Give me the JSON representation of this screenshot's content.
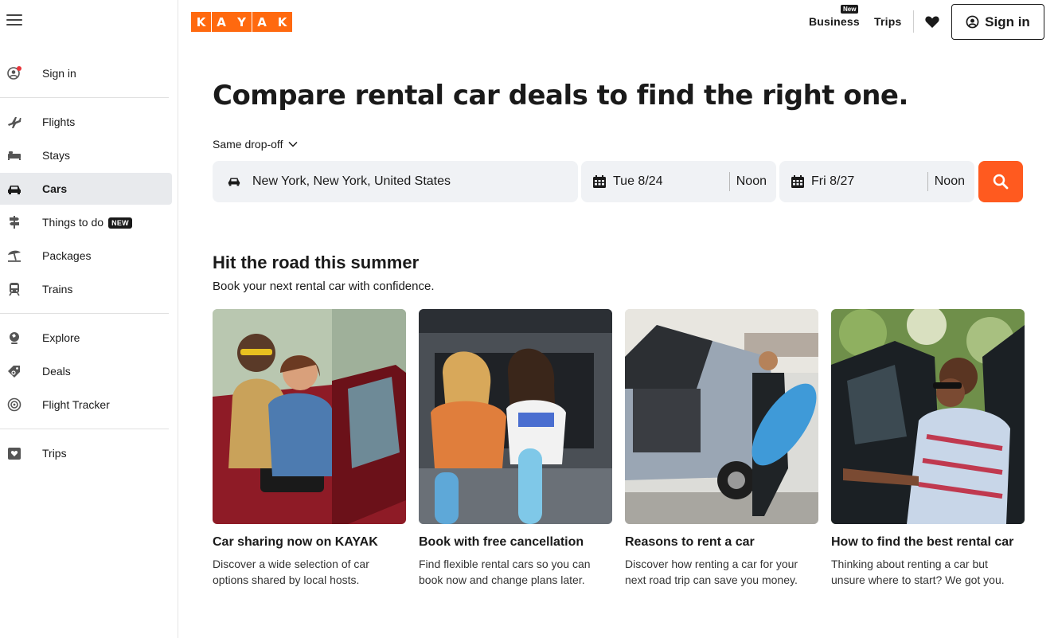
{
  "sidebar": {
    "signin": "Sign in",
    "items": [
      {
        "label": "Flights",
        "icon": "plane-icon"
      },
      {
        "label": "Stays",
        "icon": "bed-icon"
      },
      {
        "label": "Cars",
        "icon": "car-icon",
        "active": true
      },
      {
        "label": "Things to do",
        "icon": "signpost-icon",
        "badge": "NEW"
      },
      {
        "label": "Packages",
        "icon": "beach-umbrella-icon"
      },
      {
        "label": "Trains",
        "icon": "train-icon"
      },
      {
        "label": "Explore",
        "icon": "globe-icon"
      },
      {
        "label": "Deals",
        "icon": "deal-tag-icon"
      },
      {
        "label": "Flight Tracker",
        "icon": "tracker-icon"
      },
      {
        "label": "Trips",
        "icon": "trips-heart-icon"
      }
    ]
  },
  "header": {
    "logo_letters": [
      "K",
      "A",
      "Y",
      "A",
      "K"
    ],
    "business": "Business",
    "business_badge": "New",
    "trips": "Trips",
    "signin": "Sign in"
  },
  "hero": {
    "title": "Compare rental car deals to find the right one.",
    "dropoff": "Same drop-off"
  },
  "search": {
    "location": "New York, New York, United States",
    "pickup_date": "Tue 8/24",
    "pickup_time": "Noon",
    "dropoff_date": "Fri 8/27",
    "dropoff_time": "Noon"
  },
  "section": {
    "title": "Hit the road this summer",
    "subtitle": "Book your next rental car with confidence."
  },
  "cards": [
    {
      "title": "Car sharing now on KAYAK",
      "desc": "Discover a wide selection of car options shared by local hosts."
    },
    {
      "title": "Book with free cancellation",
      "desc": "Find flexible rental cars so you can book now and change plans later."
    },
    {
      "title": "Reasons to rent a car",
      "desc": "Discover how renting a car for your next road trip can save you money."
    },
    {
      "title": "How to find the best rental car",
      "desc": "Thinking about renting a car but unsure where to start? We got you."
    }
  ],
  "colors": {
    "brand": "#ff690f",
    "search_button": "#ff5a1f",
    "active_nav": "#e8eaed",
    "field_bg": "#f0f2f5"
  }
}
